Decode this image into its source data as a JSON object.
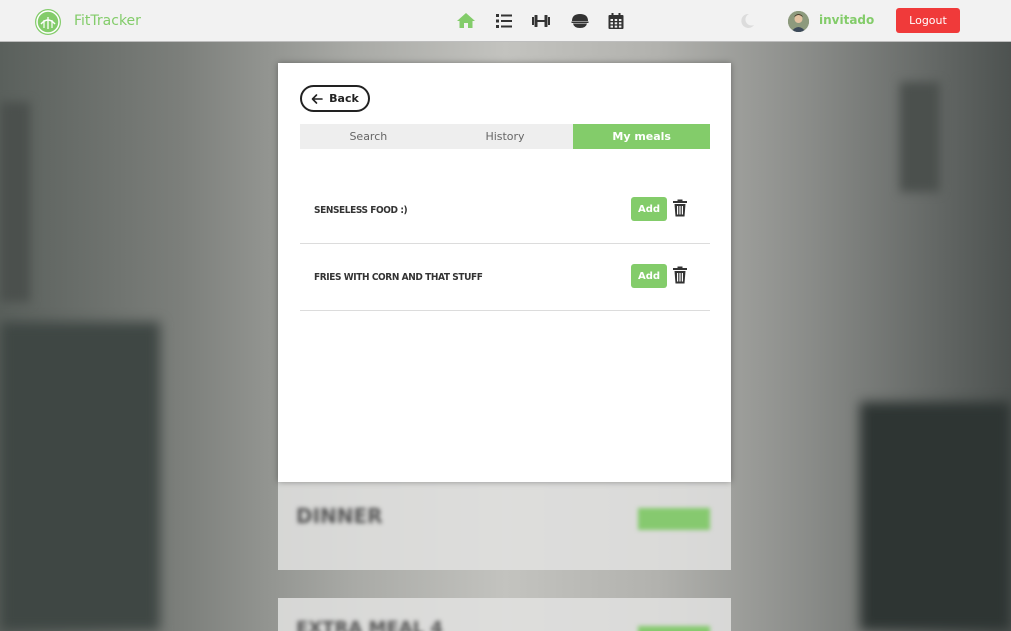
{
  "navbar": {
    "brand": "FitTracker",
    "username": "invitado",
    "logout_label": "Logout",
    "accent_color": "#83cc6a",
    "logout_color": "#f03a3a",
    "nav_icons": [
      "home-icon",
      "list-icon",
      "dumbbell-icon",
      "bowl-icon",
      "calendar-icon"
    ],
    "active_nav": "home-icon"
  },
  "modal": {
    "back_label": "Back",
    "tabs": [
      {
        "label": "Search",
        "active": false
      },
      {
        "label": "History",
        "active": false
      },
      {
        "label": "My meals",
        "active": true
      }
    ],
    "meals": [
      {
        "name": "Senseless food :)",
        "add_label": "Add"
      },
      {
        "name": "Fries with corn and that stuff",
        "add_label": "Add"
      }
    ]
  },
  "background_cards": [
    {
      "title": "DINNER"
    },
    {
      "title": "EXTRA MEAL 4"
    }
  ]
}
